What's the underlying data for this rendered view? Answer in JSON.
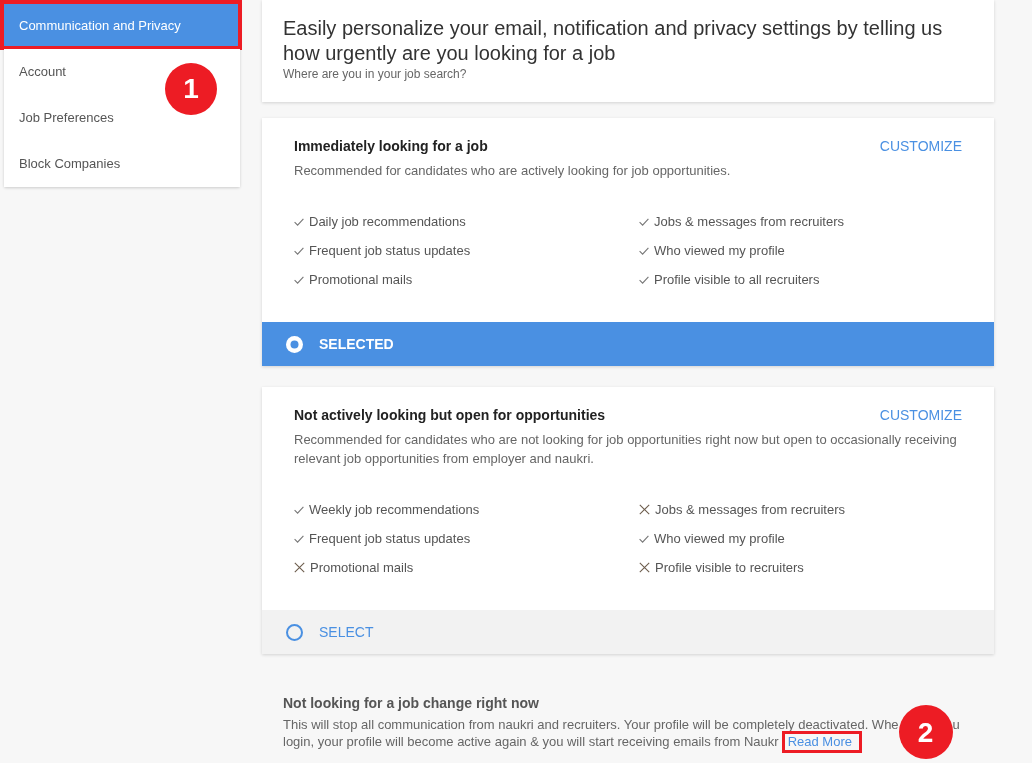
{
  "sidebar": {
    "items": [
      {
        "label": "Communication and Privacy",
        "selected": true,
        "annotated": true
      },
      {
        "label": "Account",
        "selected": false,
        "annotated": false
      },
      {
        "label": "Job Preferences",
        "selected": false,
        "annotated": false
      },
      {
        "label": "Block Companies",
        "selected": false,
        "annotated": false
      }
    ],
    "callout_number": "1"
  },
  "header": {
    "title": "Easily personalize your email, notification and privacy settings by telling us how urgently are you looking for a job",
    "subtitle": "Where are you in your job search?"
  },
  "options": [
    {
      "title": "Immediately looking for a job",
      "action": "CUSTOMIZE",
      "description": "Recommended for candidates who are actively looking for job opportunities.",
      "features": [
        {
          "label": "Daily job recommendations",
          "included": true
        },
        {
          "label": "Jobs & messages from recruiters",
          "included": true
        },
        {
          "label": "Frequent job status updates",
          "included": true
        },
        {
          "label": "Who viewed my profile",
          "included": true
        },
        {
          "label": "Promotional mails",
          "included": true
        },
        {
          "label": "Profile visible to all recruiters",
          "included": true
        }
      ],
      "selected": true,
      "footer_label": "SELECTED"
    },
    {
      "title": "Not actively looking but open for opportunities",
      "action": "CUSTOMIZE",
      "description": "Recommended for candidates who are not looking for job opportunities right now but open to occasionally receiving relevant job opportunities from employer and naukri.",
      "features": [
        {
          "label": "Weekly job recommendations",
          "included": true
        },
        {
          "label": "Jobs & messages from recruiters",
          "included": false
        },
        {
          "label": "Frequent job status updates",
          "included": true
        },
        {
          "label": "Who viewed my profile",
          "included": true
        },
        {
          "label": "Promotional mails",
          "included": false
        },
        {
          "label": "Profile visible to recruiters",
          "included": false
        }
      ],
      "selected": false,
      "footer_label": "SELECT"
    }
  ],
  "opt_out": {
    "title": "Not looking for a job change right now",
    "text_segments": [
      "This will stop all communication from naukri and recruiters. Your profile will be completely deactivated. Whe",
      "u",
      "login, your profile will become active again & you will start receiving emails from Naukr"
    ],
    "link": {
      "label": "Read More",
      "annotated": true
    },
    "callout_number": "2"
  }
}
